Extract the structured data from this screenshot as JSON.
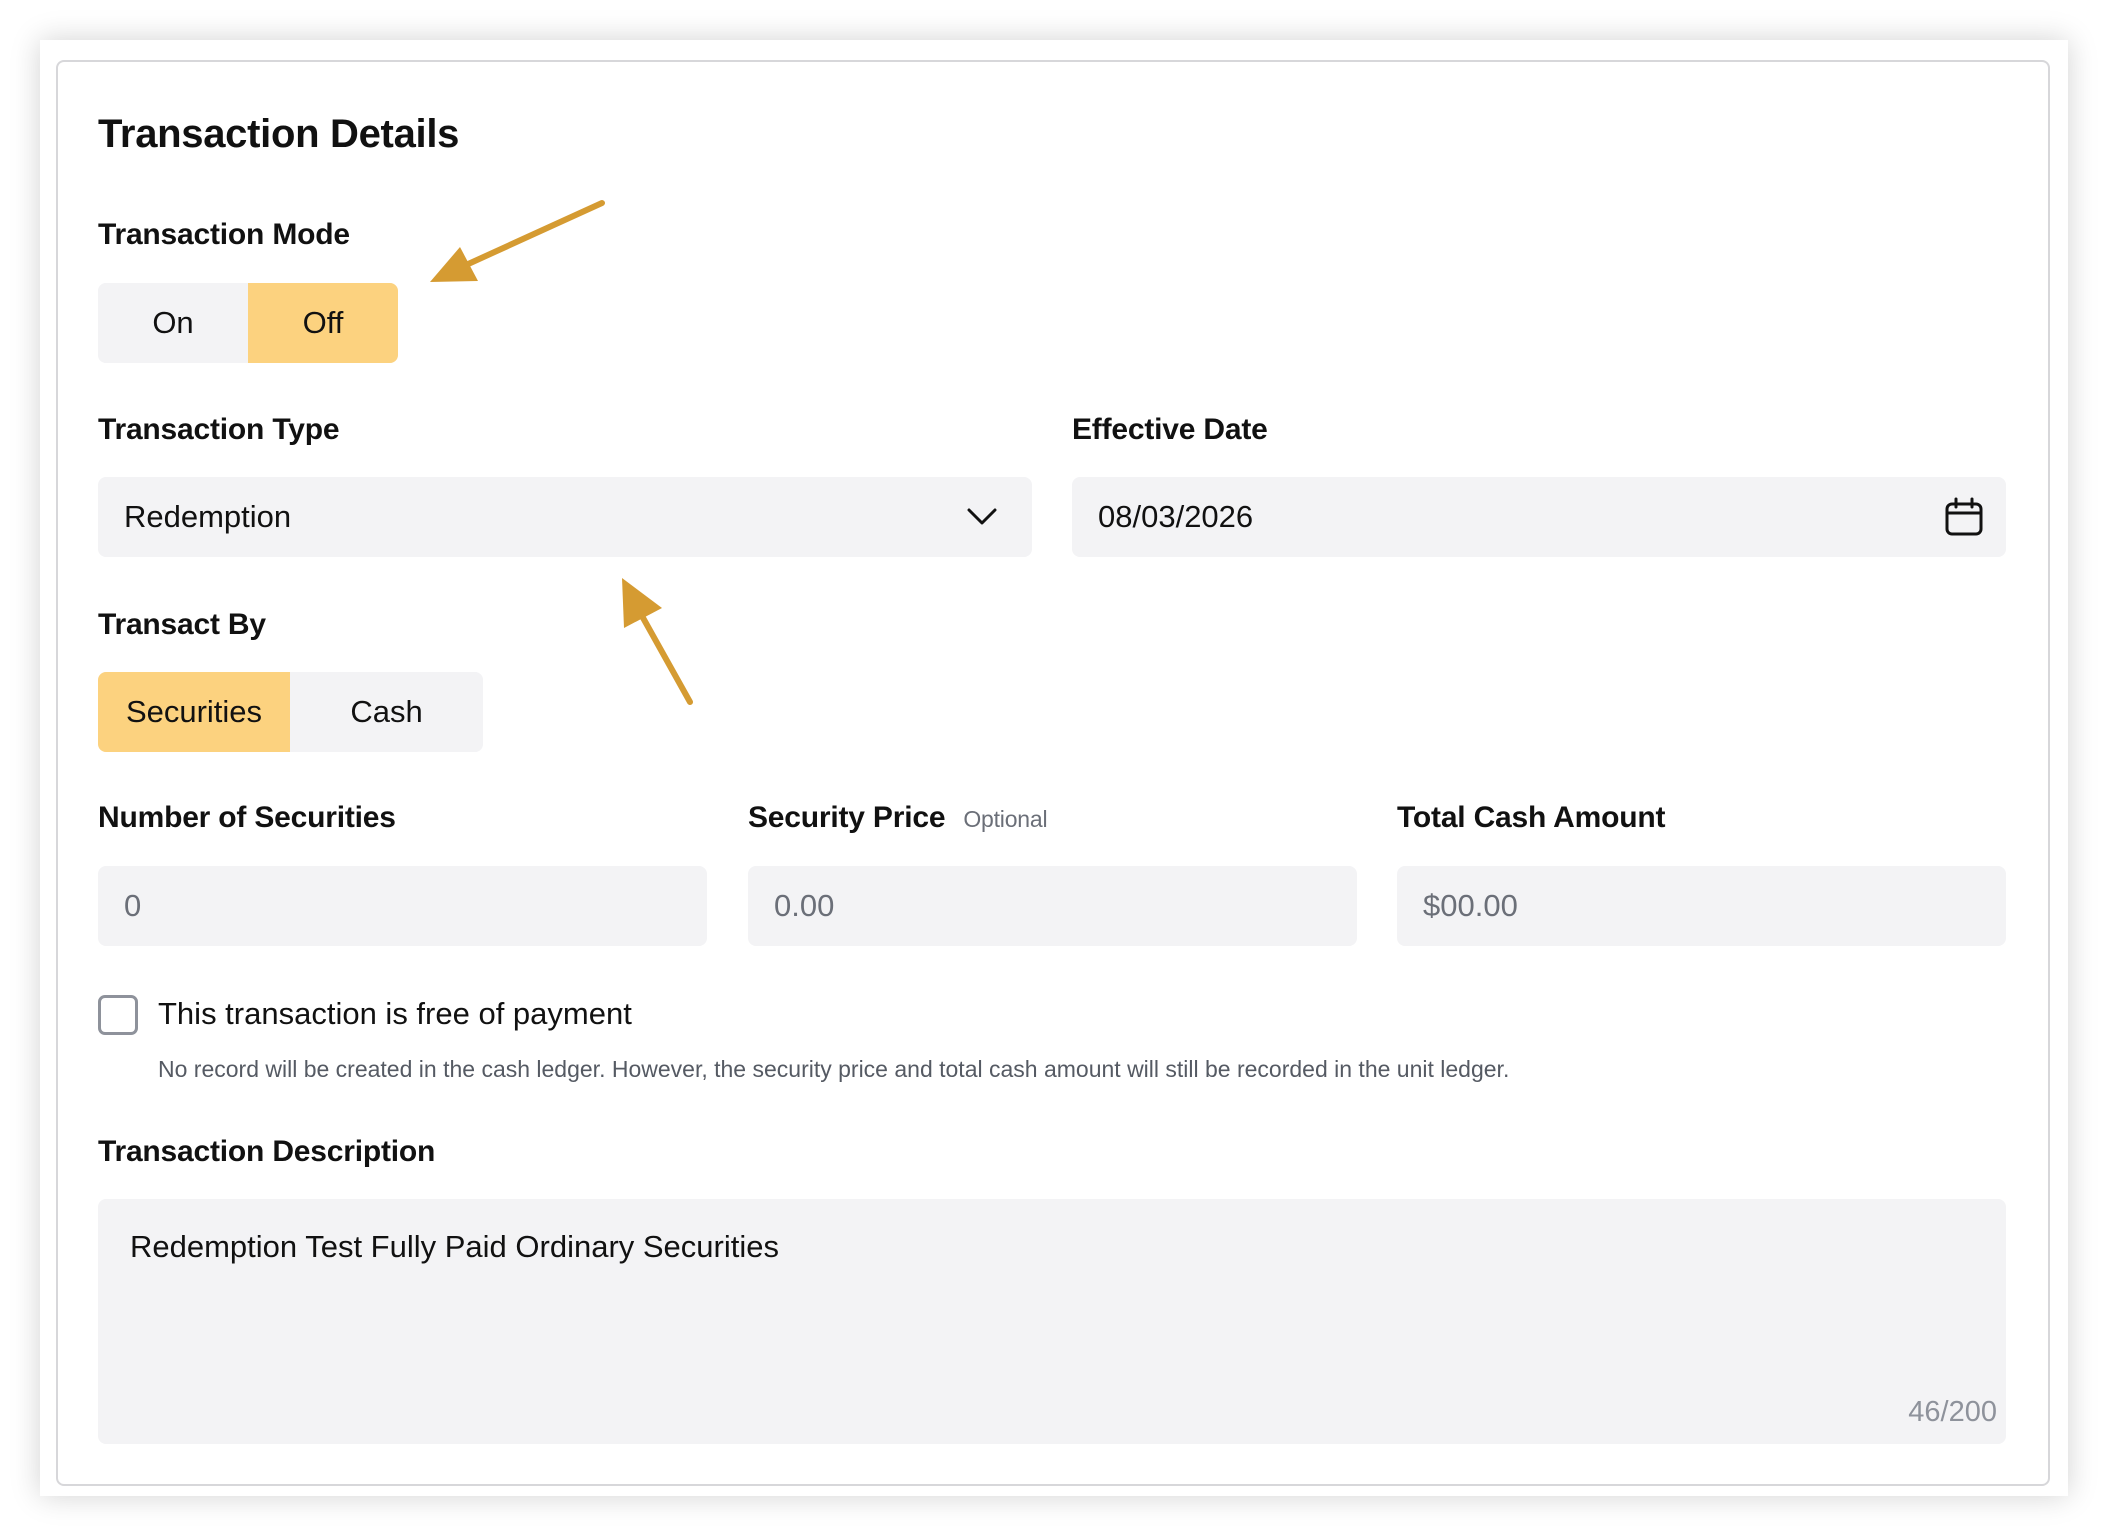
{
  "title": "Transaction Details",
  "mode": {
    "label": "Transaction Mode",
    "options": [
      "On",
      "Off"
    ],
    "selected": "Off"
  },
  "type": {
    "label": "Transaction Type",
    "value": "Redemption"
  },
  "effective_date": {
    "label": "Effective Date",
    "value": "08/03/2026"
  },
  "transact_by": {
    "label": "Transact By",
    "options": [
      "Securities",
      "Cash"
    ],
    "selected": "Securities"
  },
  "number_of_securities": {
    "label": "Number of Securities",
    "placeholder": "0"
  },
  "security_price": {
    "label": "Security Price",
    "optional": "Optional",
    "placeholder": "0.00"
  },
  "total_cash_amount": {
    "label": "Total Cash Amount",
    "placeholder": "$00.00"
  },
  "free_of_payment": {
    "label": "This transaction is free of payment",
    "checked": false,
    "hint": "No record will be created in the cash ledger. However, the security price and total cash amount will still be recorded in the unit ledger."
  },
  "description": {
    "label": "Transaction Description",
    "value": "Redemption Test Fully Paid Ordinary Securities",
    "counter": "46/200"
  },
  "colors": {
    "accent": "#fcd27f",
    "field_bg": "#f3f3f5",
    "arrow": "#d59b32"
  },
  "icons": [
    "chevron-down-icon",
    "calendar-icon",
    "annotation-arrow"
  ]
}
